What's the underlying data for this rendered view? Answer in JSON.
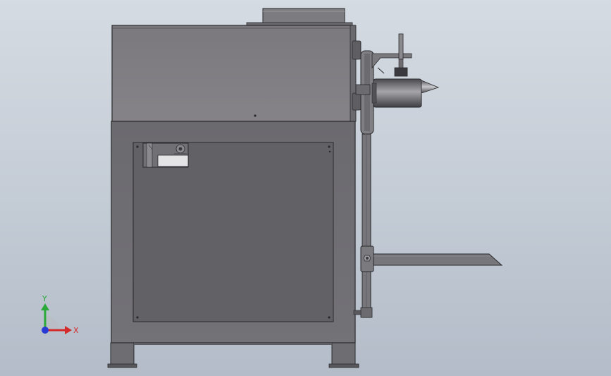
{
  "viewport": {
    "background_top": "#d5dbe2",
    "background_bottom": "#b3bcc8"
  },
  "model": {
    "body_color": "#6e6d71",
    "upper_housing_color": "#7d7b80",
    "panel_color": "#636267",
    "edge_color": "#2a2a2c"
  },
  "triad": {
    "x_label": "X",
    "y_label": "Y",
    "x_color": "#d42a2a",
    "y_color": "#2aa83a",
    "z_color": "#2a3ad4"
  },
  "icons": [
    "coordinate-triad-icon"
  ]
}
